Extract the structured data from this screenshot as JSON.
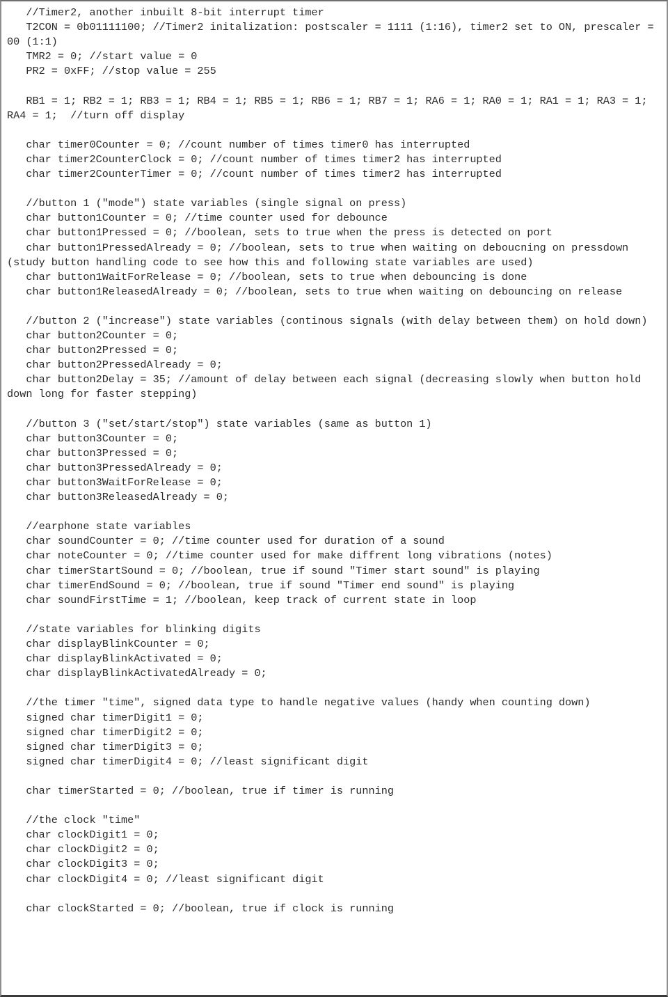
{
  "document": {
    "type": "source-code-listing",
    "language": "C",
    "colors": {
      "background": "#ffffff",
      "text": "#2b2b2b",
      "border_side": "#8e8e8e",
      "border_bottom": "#3a3a3a"
    },
    "lines": [
      "   //Timer2, another inbuilt 8-bit interrupt timer",
      "   T2CON = 0b01111100; //Timer2 initalization: postscaler = 1111 (1:16), timer2 set to ON, prescaler = 00 (1:1)",
      "   TMR2 = 0; //start value = 0",
      "   PR2 = 0xFF; //stop value = 255",
      "",
      "   RB1 = 1; RB2 = 1; RB3 = 1; RB4 = 1; RB5 = 1; RB6 = 1; RB7 = 1; RA6 = 1; RA0 = 1; RA1 = 1; RA3 = 1; RA4 = 1;  //turn off display",
      "",
      "   char timer0Counter = 0; //count number of times timer0 has interrupted",
      "   char timer2CounterClock = 0; //count number of times timer2 has interrupted",
      "   char timer2CounterTimer = 0; //count number of times timer2 has interrupted",
      "",
      "   //button 1 (\"mode\") state variables (single signal on press)",
      "   char button1Counter = 0; //time counter used for debounce",
      "   char button1Pressed = 0; //boolean, sets to true when the press is detected on port",
      "   char button1PressedAlready = 0; //boolean, sets to true when waiting on deboucning on pressdown (study button handling code to see how this and following state variables are used)",
      "   char button1WaitForRelease = 0; //boolean, sets to true when debouncing is done",
      "   char button1ReleasedAlready = 0; //boolean, sets to true when waiting on debouncing on release",
      "",
      "   //button 2 (\"increase\") state variables (continous signals (with delay between them) on hold down)",
      "   char button2Counter = 0;",
      "   char button2Pressed = 0;",
      "   char button2PressedAlready = 0;",
      "   char button2Delay = 35; //amount of delay between each signal (decreasing slowly when button hold down long for faster stepping)",
      "",
      "   //button 3 (\"set/start/stop\") state variables (same as button 1)",
      "   char button3Counter = 0;",
      "   char button3Pressed = 0;",
      "   char button3PressedAlready = 0;",
      "   char button3WaitForRelease = 0;",
      "   char button3ReleasedAlready = 0;",
      "",
      "   //earphone state variables",
      "   char soundCounter = 0; //time counter used for duration of a sound",
      "   char noteCounter = 0; //time counter used for make diffrent long vibrations (notes)",
      "   char timerStartSound = 0; //boolean, true if sound \"Timer start sound\" is playing",
      "   char timerEndSound = 0; //boolean, true if sound \"Timer end sound\" is playing",
      "   char soundFirstTime = 1; //boolean, keep track of current state in loop",
      "",
      "   //state variables for blinking digits",
      "   char displayBlinkCounter = 0;",
      "   char displayBlinkActivated = 0;",
      "   char displayBlinkActivatedAlready = 0;",
      "",
      "   //the timer \"time\", signed data type to handle negative values (handy when counting down)",
      "   signed char timerDigit1 = 0;",
      "   signed char timerDigit2 = 0;",
      "   signed char timerDigit3 = 0;",
      "   signed char timerDigit4 = 0; //least significant digit",
      "",
      "   char timerStarted = 0; //boolean, true if timer is running",
      "",
      "   //the clock \"time\"",
      "   char clockDigit1 = 0;",
      "   char clockDigit2 = 0;",
      "   char clockDigit3 = 0;",
      "   char clockDigit4 = 0; //least significant digit",
      "",
      "   char clockStarted = 0; //boolean, true if clock is running"
    ]
  }
}
